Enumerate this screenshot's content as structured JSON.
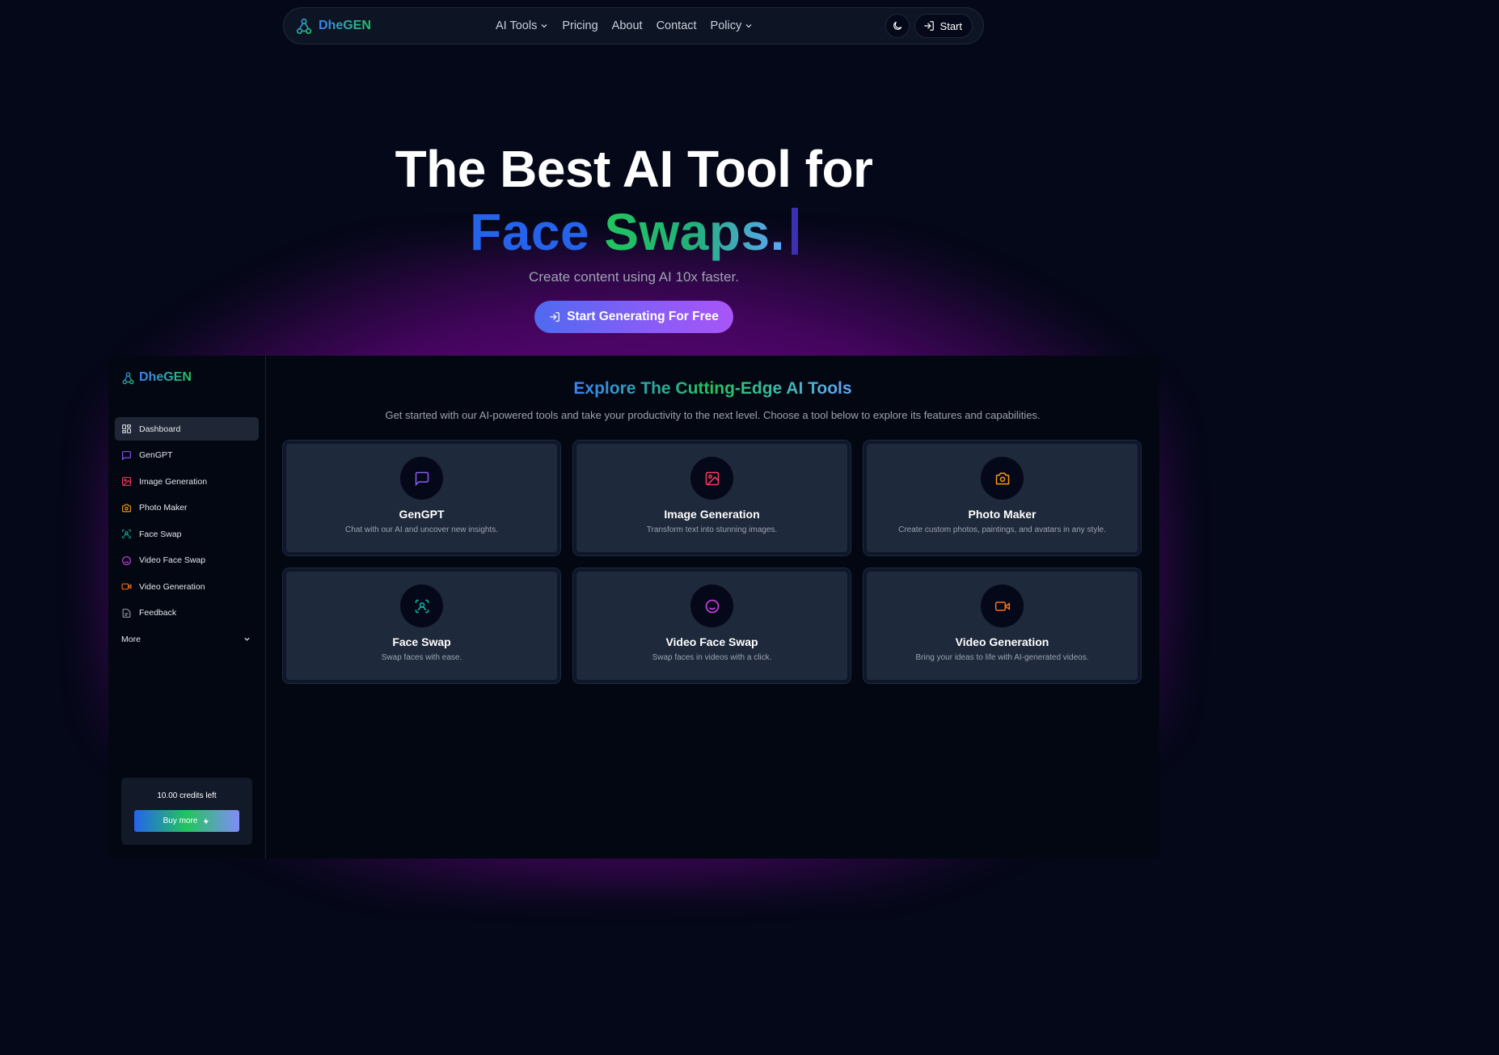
{
  "nav": {
    "brand": "DheGEN",
    "links": [
      {
        "label": "AI Tools",
        "dropdown": true
      },
      {
        "label": "Pricing",
        "dropdown": false
      },
      {
        "label": "About",
        "dropdown": false
      },
      {
        "label": "Contact",
        "dropdown": false
      },
      {
        "label": "Policy",
        "dropdown": true
      }
    ],
    "theme_icon": "moon-icon",
    "start_label": "Start"
  },
  "hero": {
    "title": "The Best AI Tool for",
    "highlight_word1": "Face",
    "highlight_word2": "Swaps.",
    "subtitle": "Create content using AI 10x faster.",
    "cta_label": "Start Generating For Free"
  },
  "sidebar": {
    "brand": "DheGEN",
    "items": [
      {
        "label": "Dashboard",
        "icon": "dashboard-icon",
        "color": "#e5e7eb",
        "active": true
      },
      {
        "label": "GenGPT",
        "icon": "chat-icon",
        "color": "#8b5cf6",
        "active": false
      },
      {
        "label": "Image Generation",
        "icon": "image-icon",
        "color": "#f43f5e",
        "active": false
      },
      {
        "label": "Photo Maker",
        "icon": "camera-icon",
        "color": "#f59e0b",
        "active": false
      },
      {
        "label": "Face Swap",
        "icon": "face-scan-icon",
        "color": "#14b8a6",
        "active": false
      },
      {
        "label": "Video Face Swap",
        "icon": "smile-icon",
        "color": "#d946ef",
        "active": false
      },
      {
        "label": "Video Generation",
        "icon": "video-icon",
        "color": "#f97316",
        "active": false
      },
      {
        "label": "Feedback",
        "icon": "feedback-icon",
        "color": "#9ca3af",
        "active": false
      }
    ],
    "more_label": "More",
    "credits_text": "10.00 credits left",
    "buy_label": "Buy more"
  },
  "main": {
    "title": "Explore The Cutting-Edge AI Tools",
    "description": "Get started with our AI-powered tools and take your productivity to the next level. Choose a tool below to explore its features and capabilities.",
    "cards": [
      {
        "title": "GenGPT",
        "desc": "Chat with our AI and uncover new insights.",
        "icon": "chat-icon",
        "color": "#8b5cf6"
      },
      {
        "title": "Image Generation",
        "desc": "Transform text into stunning images.",
        "icon": "image-icon",
        "color": "#f43f5e"
      },
      {
        "title": "Photo Maker",
        "desc": "Create custom photos, paintings, and avatars in any style.",
        "icon": "camera-icon",
        "color": "#f59e0b"
      },
      {
        "title": "Face Swap",
        "desc": "Swap faces with ease.",
        "icon": "face-scan-icon",
        "color": "#14b8a6"
      },
      {
        "title": "Video Face Swap",
        "desc": "Swap faces in videos with a click.",
        "icon": "smile-icon",
        "color": "#d946ef"
      },
      {
        "title": "Video Generation",
        "desc": "Bring your ideas to life with AI-generated videos.",
        "icon": "video-icon",
        "color": "#f97316"
      }
    ]
  }
}
